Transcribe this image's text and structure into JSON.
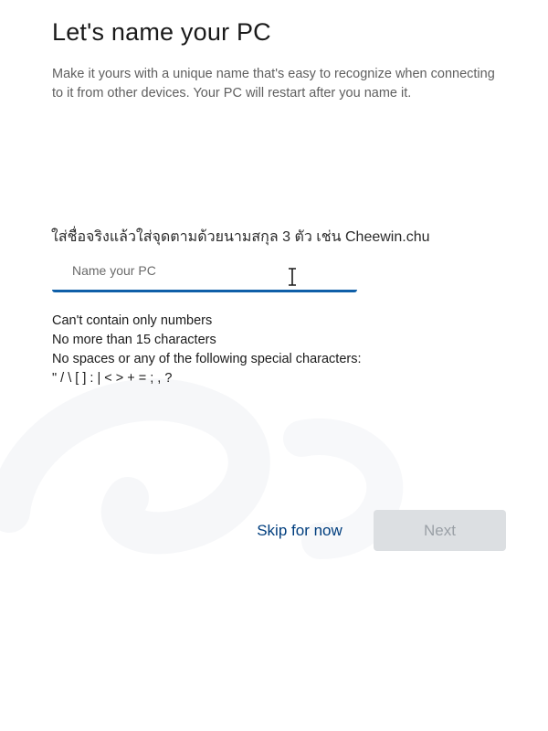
{
  "header": {
    "title": "Let's name your PC",
    "description": "Make it yours with a unique name that's easy to recognize when connecting to it from other devices. Your PC will restart after you name it."
  },
  "instruction": {
    "thai_hint": "ใส่ชื่อจริงแล้วใส่จุดตามด้วยนามสกุล 3 ตัว เช่น Cheewin.chu"
  },
  "name_field": {
    "placeholder": "Name your PC",
    "value": ""
  },
  "rules": [
    "Can't contain only numbers",
    "No more than 15 characters",
    "No spaces or any of the following special characters:",
    "\" / \\ [ ] : | < > + = ; , ?"
  ],
  "actions": {
    "skip_label": "Skip for now",
    "next_label": "Next",
    "next_enabled": false
  },
  "colors": {
    "accent": "#0f5fa8",
    "link": "#003e7e",
    "disabled_bg": "#dcdfe2",
    "disabled_text": "#9aa0a6"
  },
  "icons": {
    "text_cursor": "i-beam-cursor-icon"
  }
}
